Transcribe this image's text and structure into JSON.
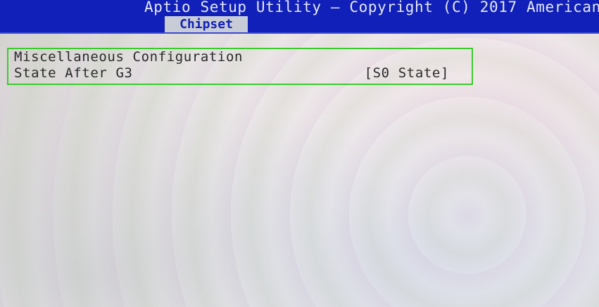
{
  "header": {
    "title": "Aptio Setup Utility – Copyright (C) 2017 American",
    "active_tab": "Chipset"
  },
  "main": {
    "section_title": "Miscellaneous Configuration",
    "settings": [
      {
        "label": "State After G3",
        "value": "[S0 State]"
      }
    ]
  },
  "colors": {
    "header_bg": "#1020b8",
    "tab_bg": "#c8ccd6",
    "highlight_border": "#3ccb2c"
  }
}
